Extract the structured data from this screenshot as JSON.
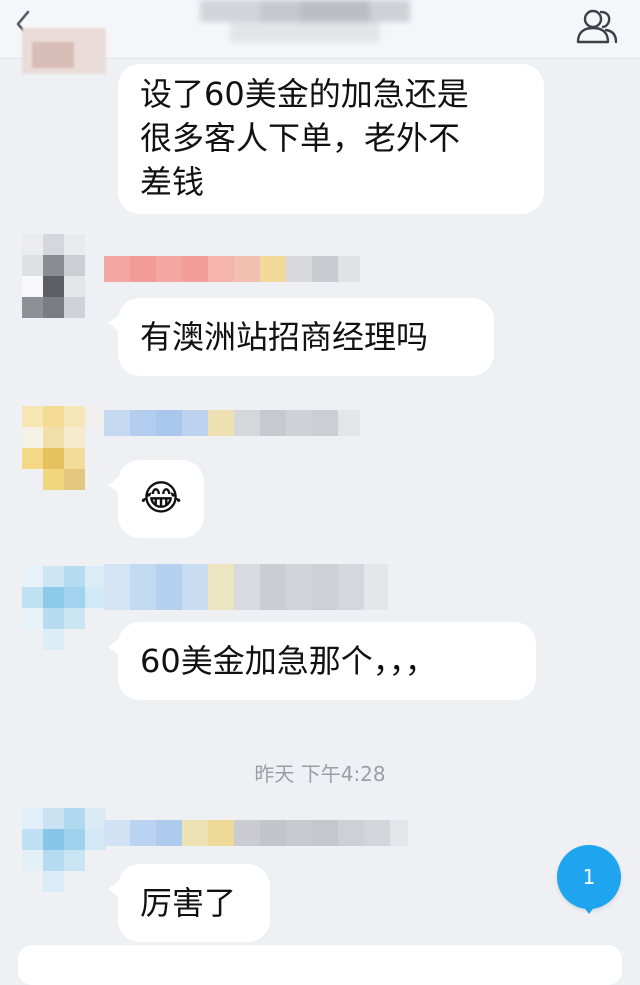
{
  "header": {
    "back_icon": "chevron-left-icon",
    "profile_icon": "group-members-icon",
    "title_obscured": true
  },
  "messages": [
    {
      "text": "设了60美金的加急还是\n很多客人下单，老外不\n差钱"
    },
    {
      "text": "有澳洲站招商经理吗"
    },
    {
      "emoji": "😂"
    },
    {
      "text": "60美金加急那个，，，"
    },
    {
      "text": "厉害了"
    }
  ],
  "timestamp": "昨天 下午4:28",
  "unread_badge": "1",
  "colors": {
    "background": "#eef0f4",
    "bubble": "#ffffff",
    "badge": "#1fa4ef",
    "timestamp": "#9a9ea6"
  }
}
